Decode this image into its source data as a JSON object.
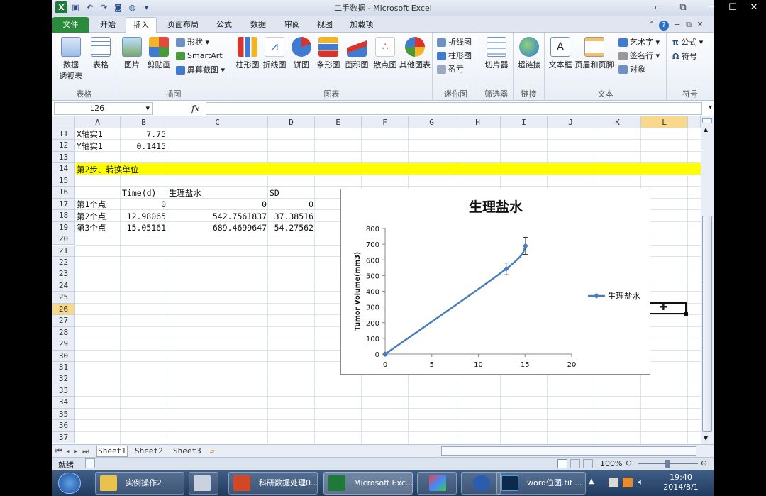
{
  "window": {
    "title": "二手数据 - Microsoft Excel",
    "minimize_glyph": "─",
    "maximize_glyph": "☐",
    "close_glyph": "✕"
  },
  "ribbon_tabs": [
    "文件",
    "开始",
    "插入",
    "页面布局",
    "公式",
    "数据",
    "审阅",
    "视图",
    "加载项"
  ],
  "active_tab": "插入",
  "ribbon_groups": {
    "tables": {
      "label": "表格",
      "pivot": "数据\n透视表",
      "pivot_line1": "数据",
      "pivot_line2": "透视表",
      "table": "表格"
    },
    "illustrations": {
      "label": "插图",
      "picture": "图片",
      "clipart": "剪贴画",
      "shapes": "形状",
      "smartart": "SmartArt",
      "screenshot": "屏幕截图"
    },
    "charts": {
      "label": "图表",
      "column": "柱形图",
      "line": "折线图",
      "pie": "饼图",
      "bar": "条形图",
      "area": "面积图",
      "scatter": "散点图",
      "other": "其他图表"
    },
    "sparklines": {
      "label": "迷你图",
      "line": "折线图",
      "column": "柱形图",
      "winloss": "盈亏"
    },
    "filter": {
      "label": "筛选器",
      "slicer": "切片器"
    },
    "links": {
      "label": "链接",
      "hyperlink": "超链接"
    },
    "text": {
      "label": "文本",
      "textbox": "文本框",
      "headerfooter": "页眉和页脚",
      "wordart": "艺术字",
      "signature": "签名行",
      "object": "对象"
    },
    "symbols": {
      "label": "符号",
      "equation": "公式",
      "symbol": "符号"
    }
  },
  "formula_bar": {
    "name_box": "L26",
    "fx": "fx",
    "value": ""
  },
  "columns": [
    "A",
    "B",
    "C",
    "D",
    "E",
    "F",
    "G",
    "H",
    "I",
    "J",
    "K",
    "L"
  ],
  "selected_column": "L",
  "rows": [
    "11",
    "12",
    "13",
    "14",
    "15",
    "16",
    "17",
    "18",
    "19",
    "20",
    "21",
    "22",
    "23",
    "24",
    "25",
    "26",
    "27",
    "28",
    "29",
    "30",
    "31",
    "32",
    "33",
    "34",
    "35",
    "36",
    "37"
  ],
  "selected_row": "26",
  "cells": {
    "a11": "X轴实1",
    "b11": "7.75",
    "a12": "Y轴实1",
    "b12": "0.1415",
    "a14": "第2步、转换单位",
    "b16": "Time(d)",
    "c16": "生理盐水",
    "d16": "SD",
    "a17": "第1个点",
    "b17": "0",
    "c17": "0",
    "d17": "0",
    "a18": "第2个点",
    "b18": "12.98065",
    "c18": "542.7561837",
    "d18": "37.38516",
    "a19": "第3个点",
    "b19": "15.05161",
    "c19": "689.4699647",
    "d19": "54.27562"
  },
  "colors": {
    "highlight": "#ffff00",
    "series": "#4a7ebb",
    "accent_tab": "#2a8b3c"
  },
  "chart_data": {
    "type": "scatter",
    "title": "生理盐水",
    "xlabel": "",
    "ylabel": "Tumor Volume(mm3)",
    "xlim": [
      0,
      20
    ],
    "ylim": [
      0,
      800
    ],
    "xticks": [
      "0",
      "5",
      "10",
      "15",
      "20"
    ],
    "yticks": [
      "0",
      "100",
      "200",
      "300",
      "400",
      "500",
      "600",
      "700",
      "800"
    ],
    "series": [
      {
        "name": "生理盐水",
        "x": [
          0,
          12.98065,
          15.05161
        ],
        "y": [
          0,
          542.7561837,
          689.4699647
        ],
        "error": [
          0,
          37.38516,
          54.27562
        ]
      }
    ],
    "legend": "right",
    "smooth": true,
    "grid": false
  },
  "sheets": [
    "Sheet1",
    "Sheet2",
    "Sheet3"
  ],
  "active_sheet": "Sheet1",
  "status": {
    "ready": "就绪",
    "zoom": "100%"
  },
  "taskbar": {
    "items": [
      "实例操作2",
      "",
      "科研数据处理0...",
      "Microsoft Exc...",
      "",
      "",
      "word位图.tif ..."
    ],
    "time": "19:40",
    "date": "2014/8/1"
  }
}
